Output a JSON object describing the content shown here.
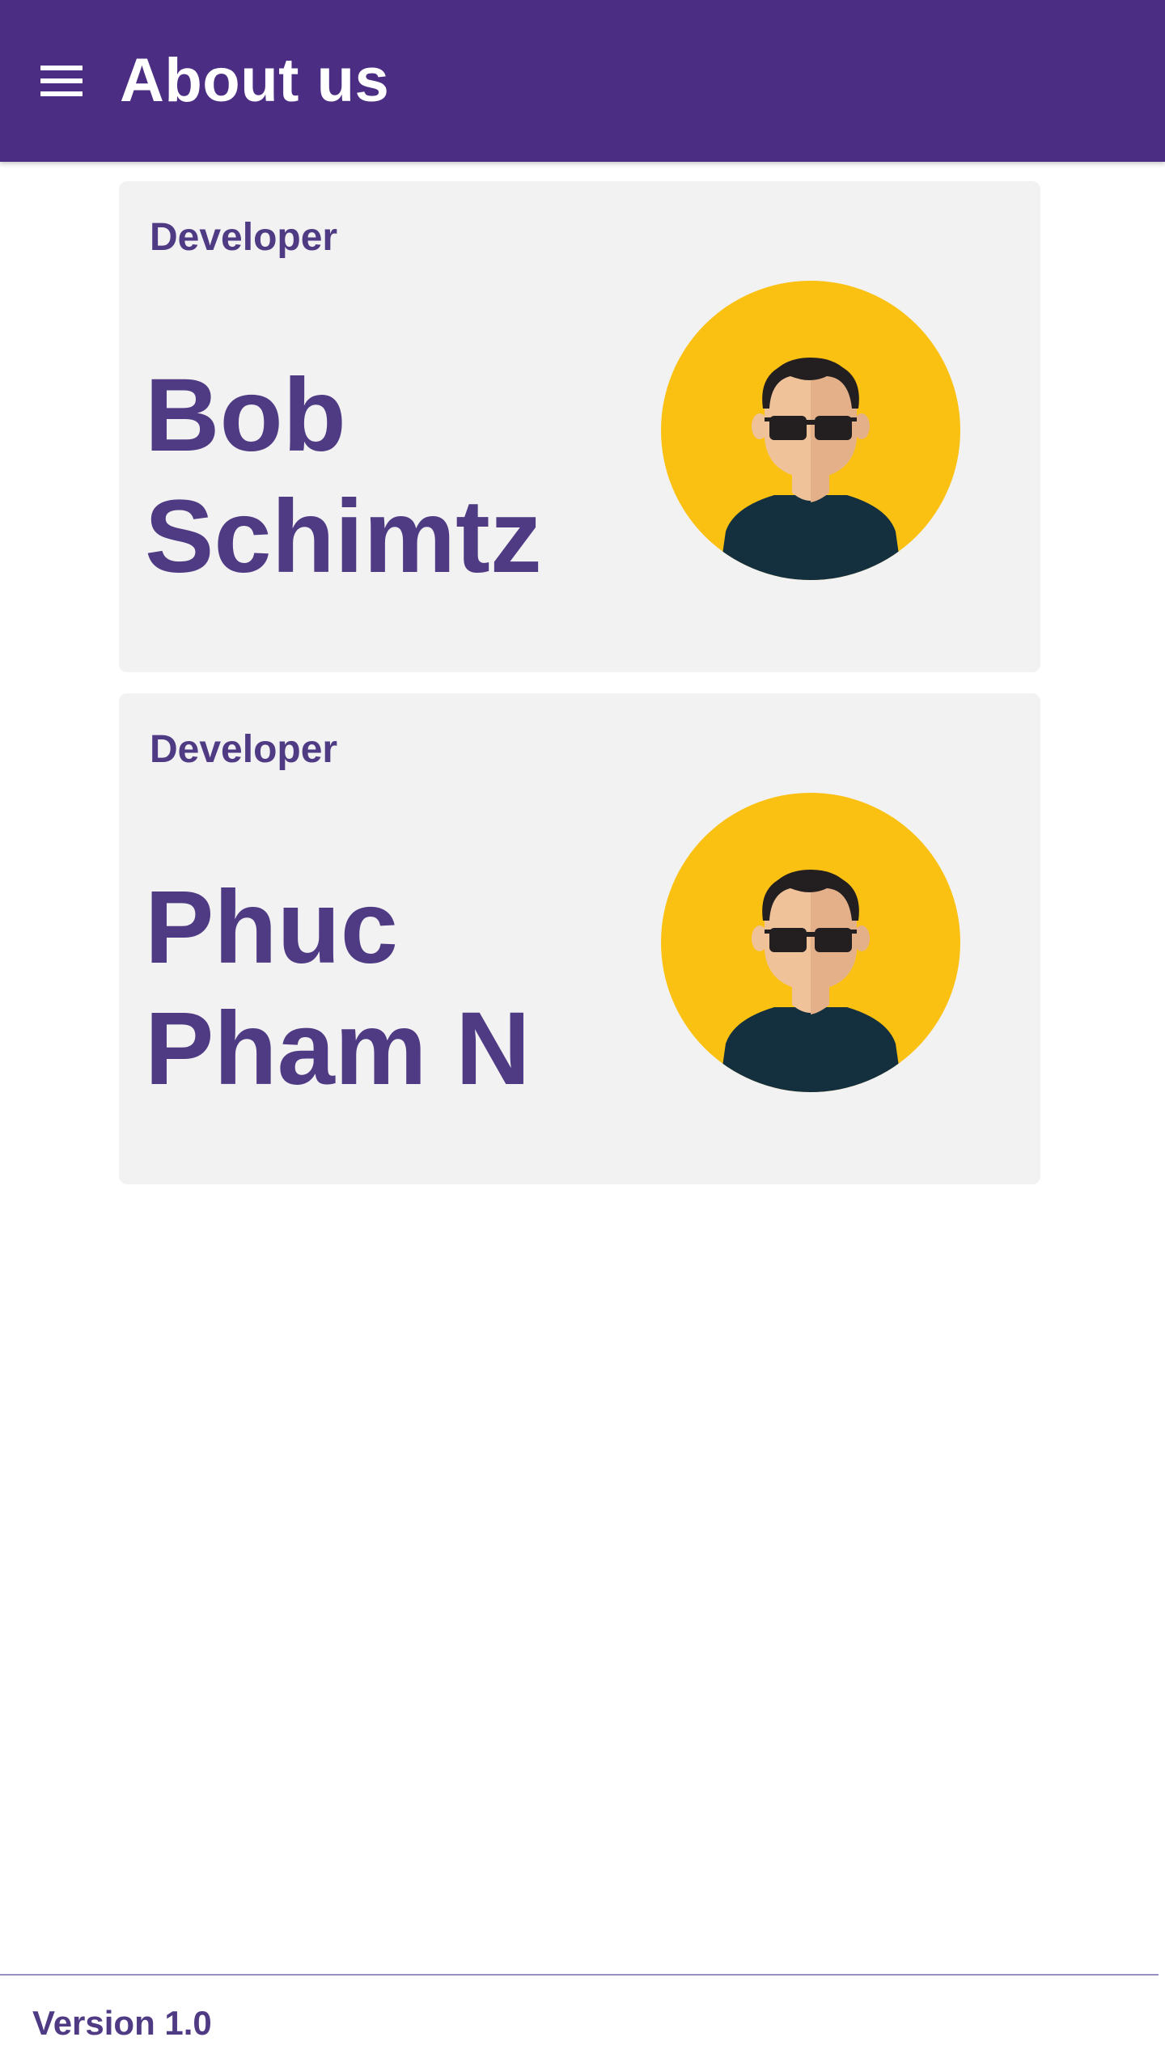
{
  "app_bar": {
    "title": "About us",
    "menu_icon": "hamburger-menu-icon",
    "background_color": "#4b2e83"
  },
  "members": [
    {
      "role": "Developer",
      "first_name": "Bob",
      "last_name": "Schimtz",
      "avatar_icon": "developer-avatar-icon"
    },
    {
      "role": "Developer",
      "first_name": "Phuc",
      "last_name": "Pham N",
      "avatar_icon": "developer-avatar-icon"
    }
  ],
  "footer": {
    "version": "Version 1.0"
  },
  "colors": {
    "accent": "#4f3a84",
    "card_background": "#f2f2f2",
    "avatar_background": "#fbc112"
  }
}
